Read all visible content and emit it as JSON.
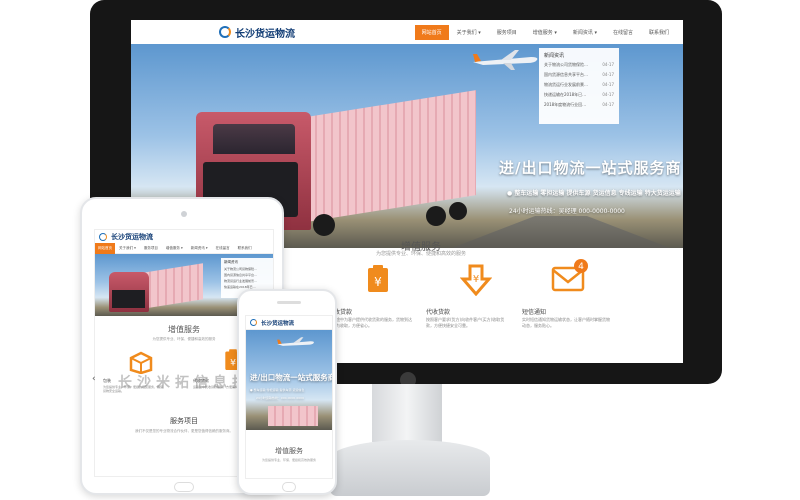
{
  "brand": {
    "logo_text": "长沙货运物流",
    "accent": "#f07a1a",
    "primary": "#123d75"
  },
  "nav": {
    "items": [
      {
        "label": "网站首页",
        "active": true
      },
      {
        "label": "关于我们 ▾"
      },
      {
        "label": "服务项目"
      },
      {
        "label": "增值服务 ▾"
      },
      {
        "label": "新闻资讯 ▾"
      },
      {
        "label": "在线留言"
      },
      {
        "label": "联系我们"
      }
    ]
  },
  "news": {
    "title": "新闻资讯",
    "items": [
      {
        "text": "关于物流公司货物保险…",
        "date": "04-17"
      },
      {
        "text": "国内货源信息共享平台…",
        "date": "04-17"
      },
      {
        "text": "物流货运行业发展前景…",
        "date": "04-17"
      },
      {
        "text": "快递运输在2018年已…",
        "date": "04-17"
      },
      {
        "text": "2018年度物流行业回…",
        "date": "04-17"
      }
    ]
  },
  "hero": {
    "headline": "进/出口物流一站式服务商",
    "tags": "● 整车运输 零担运输 提供车源 货运信息 专线运输 特大货运运输",
    "hotline": "24小时运输热线：吴经理 000-0000-0000"
  },
  "value_services": {
    "title": "增值服务",
    "subtitle": "为您提供专业、环保、便捷和高效的服务",
    "items": [
      {
        "name": "包装",
        "icon": "box-icon",
        "desc": "包装服务是在物流运输过程中对货物进行保护的专业服务，确保货物完好无损。"
      },
      {
        "name": "代收贷款",
        "icon": "yen-clipboard-icon",
        "desc": "代收贷款是指在运输途中为客户代收货款的增值服务，货物送达后收款。"
      },
      {
        "name": "代收货款",
        "icon": "yen-download-icon",
        "desc": "按照客户要求(货方)向收件客户(买方)收取货款，方便快捷安全可靠。"
      },
      {
        "name": "短信通知",
        "icon": "mail-icon",
        "badge": "4",
        "desc": "您的货物运输状态发生变化时，系统将通过短信及时通知您货物信息。"
      }
    ]
  },
  "desktop_services_visible": [
    {
      "name": "代收贷款",
      "desc": "运输途中为客户提供代收货款的服务，货物到达后代为收取，方便省心。"
    },
    {
      "name": "代收货款",
      "desc": "按照客户要求(货方)向收件客户(买方)收取货款，方便快捷安全可靠。"
    },
    {
      "name": "短信通知",
      "desc": "实时短信通知货物运输状态，让客户随时掌握货物动态，服务贴心。"
    }
  ],
  "tablet": {
    "services_title": "增值服务",
    "services_sub": "为您提供专业、环保、便捷和高效的服务",
    "items": [
      {
        "name": "包装",
        "desc": "为您提供专业、环保、便捷的包装服务，确保货物安全运输。"
      },
      {
        "name": "代收贷款",
        "desc": "运输途中代收货款服务，方便客户资金周转。"
      }
    ],
    "project_title": "服务项目",
    "project_desc": "我们不仅是您的专业物流合作伙伴，更是您值得信赖的服务商。"
  },
  "phone": {
    "headline": "进/出口物流一站式服务商",
    "tags": "● 整车运输 零担运输 提供车源 货运信息",
    "hotline": "24小时运输热线：000-0000-0000",
    "services_title": "增值服务",
    "services_sub": "为您提供专业、环保、便捷和高效的服务"
  },
  "watermark": "长沙米拓信息技术"
}
